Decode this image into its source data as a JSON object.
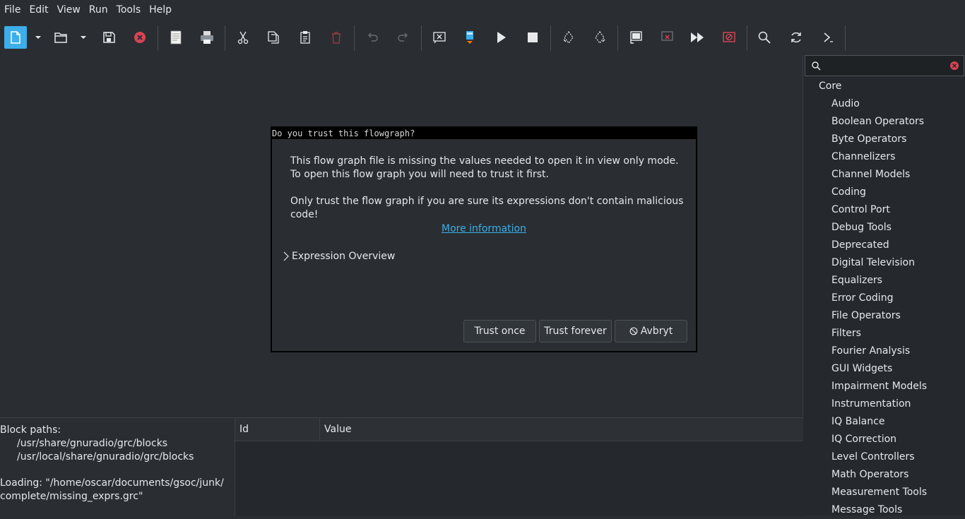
{
  "menu": [
    "File",
    "Edit",
    "View",
    "Run",
    "Tools",
    "Help"
  ],
  "toolbar_icons": [
    "new-flowgraph-icon",
    "new-dropdown-icon",
    "open-icon",
    "open-dropdown-icon",
    "save-icon",
    "close-icon",
    "generate-report-icon",
    "print-icon",
    "cut-icon",
    "copy-icon",
    "paste-icon",
    "delete-icon",
    "undo-icon",
    "redo-icon",
    "errors-icon",
    "generate-icon",
    "execute-icon",
    "kill-icon",
    "rotate-ccw-icon",
    "rotate-cw-icon",
    "enable-icon",
    "disable-icon",
    "bypass-icon",
    "disable-red-icon",
    "find-icon",
    "reload-icon",
    "more-icon"
  ],
  "colors": {
    "accent": "#3daee9",
    "danger": "#da4453",
    "background": "#2a2e32"
  },
  "library": {
    "search_placeholder": "",
    "root": "Core",
    "categories": [
      "Audio",
      "Boolean Operators",
      "Byte Operators",
      "Channelizers",
      "Channel Models",
      "Coding",
      "Control Port",
      "Debug Tools",
      "Deprecated",
      "Digital Television",
      "Equalizers",
      "Error Coding",
      "File Operators",
      "Filters",
      "Fourier Analysis",
      "GUI Widgets",
      "Impairment Models",
      "Instrumentation",
      "IQ Balance",
      "IQ Correction",
      "Level Controllers",
      "Math Operators",
      "Measurement Tools",
      "Message Tools"
    ]
  },
  "console": {
    "block_paths_label": "Block paths:",
    "paths": [
      "/usr/share/gnuradio/grc/blocks",
      "/usr/local/share/gnuradio/grc/blocks"
    ],
    "loading_line1": "Loading: \"/home/oscar/documents/gsoc/junk/",
    "loading_line2": "complete/missing_exprs.grc\""
  },
  "variables": {
    "col_id": "Id",
    "col_value": "Value"
  },
  "dialog": {
    "title": "Do you trust this flowgraph?",
    "message": "This flow graph file is missing the values needed to open it in view only mode. To open this flow graph you will need to trust it first.",
    "warning": "Only trust the flow graph if you are sure its expressions don't contain malicious code!",
    "link": "More information",
    "expander": "Expression Overview",
    "buttons": {
      "trust_once": "Trust once",
      "trust_forever": "Trust forever",
      "cancel": "Avbryt"
    }
  }
}
